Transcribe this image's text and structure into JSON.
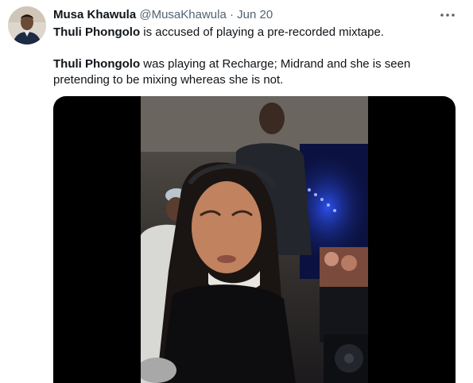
{
  "tweet": {
    "author_name": "Musa Khawula",
    "author_handle": "@MusaKhawula",
    "separator": "·",
    "date": "Jun 20",
    "more_icon": "ellipsis-icon",
    "paragraph1": {
      "bold": "Thuli Phongolo",
      "rest": " is accused of playing a pre-recorded mixtape."
    },
    "paragraph2": {
      "bold": "Thuli Phongolo",
      "rest": " was playing at Recharge; Midrand and she is seen pretending to be mixing whereas she is not."
    }
  },
  "colors": {
    "text_primary": "#0f1419",
    "text_secondary": "#536471",
    "media_background": "#000000"
  }
}
